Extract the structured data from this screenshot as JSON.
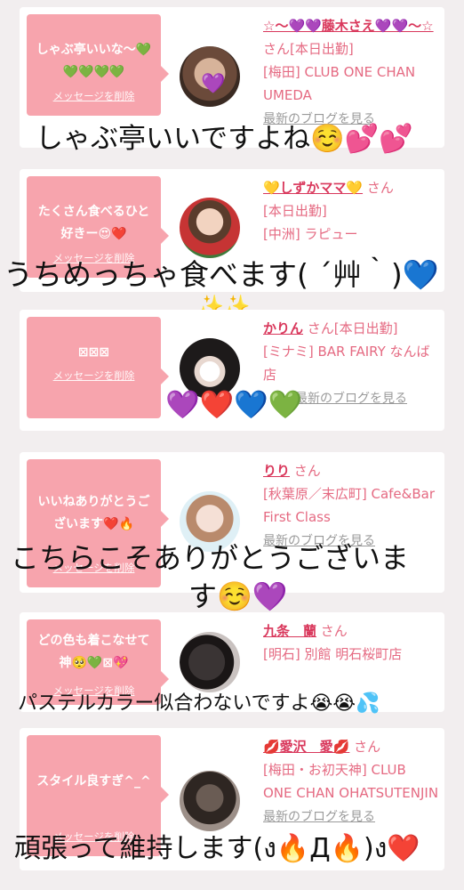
{
  "delete_label": "メッセージを削除",
  "blog_label": "最新のブログを見る",
  "cards": [
    {
      "message": "しゃぶ亭いいな〜💚💚💚💚💚",
      "name": "☆〜💜💜藤木さえ💜💜〜☆",
      "san": "さん[本日出勤]",
      "location": "[梅田] CLUB ONE CHAN UMEDA"
    },
    {
      "message": "たくさん食べるひと好きー😍❤️",
      "name": "💛しずかママ💛",
      "san": "さん",
      "status": "[本日出勤]",
      "location": "[中洲] ラピュー"
    },
    {
      "message": "⊠⊠⊠",
      "name": "かりん",
      "san": "さん[本日出勤]",
      "location": "[ミナミ] BAR FAIRY なんば店"
    },
    {
      "message": "いいねありがとうございます❤️🔥",
      "name": "りり",
      "san": "さん",
      "location": "[秋葉原／末広町] Cafe&Bar First Class"
    },
    {
      "message": "どの色も着こなせて神🥺💚⊠💖",
      "name": "九条　蘭",
      "san": "さん",
      "location": "[明石] 別館 明石桜町店"
    },
    {
      "message": "スタイル良すぎ^_^",
      "name": "💋愛沢　愛💋",
      "san": "さん",
      "location": "[梅田・お初天神] CLUB ONE CHAN OHATSUTENJIN"
    }
  ],
  "replies": [
    "しゃぶ亭いいですよね☺️💕💕",
    "うちめっちゃ食べます( ´艸｀)💙",
    "✨✨",
    "💜❤️💙💚",
    "こちらこそありがとうございま",
    "す☺️💜",
    "パステルカラー似合わないですよ😭😭💦",
    "頑張って維持します(ง🔥Д🔥)ง❤️"
  ],
  "colors": {
    "bubble": "#f7a4ad",
    "name": "#d9385c",
    "text": "#e56a82",
    "background": "#f2eeef"
  }
}
